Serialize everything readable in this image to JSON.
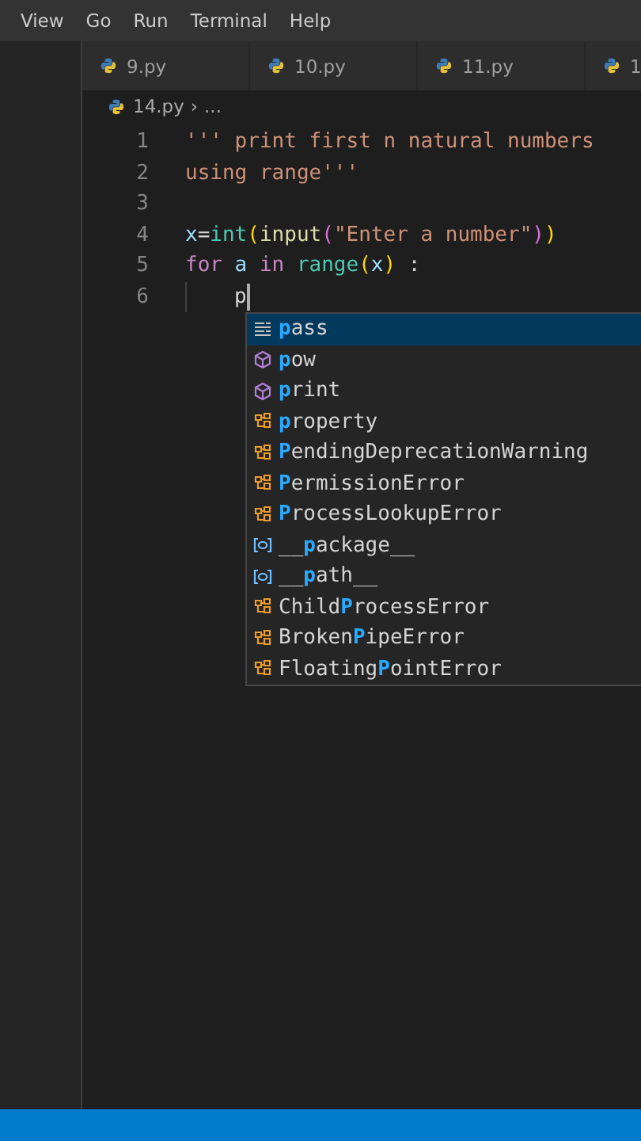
{
  "menu_bar": {
    "items": [
      "View",
      "Go",
      "Run",
      "Terminal",
      "Help"
    ]
  },
  "tabs": [
    {
      "label": "9.py"
    },
    {
      "label": "10.py"
    },
    {
      "label": "11.py"
    },
    {
      "label": "1"
    }
  ],
  "breadcrumb": {
    "file": "14.py",
    "separator": "›",
    "symbol": "..."
  },
  "editor": {
    "lines": [
      {
        "number": "1",
        "tokens": [
          {
            "text": "''' print first n natural numbers",
            "color": "#ce9178"
          }
        ]
      },
      {
        "number": "2",
        "tokens": [
          {
            "text": "using range'''",
            "color": "#ce9178"
          }
        ]
      },
      {
        "number": "3"
      },
      {
        "number": "4",
        "tokens": [
          {
            "text": "x",
            "color": "#9cdcfe"
          },
          {
            "text": "=",
            "color": "#d4d4d4"
          },
          {
            "text": "int",
            "color": "#4ec9b0"
          },
          {
            "text": "(",
            "color": "#ffd700"
          },
          {
            "text": "input",
            "color": "#dcdcaa"
          },
          {
            "text": "(",
            "color": "#da70d6"
          },
          {
            "text": "\"Enter a number\"",
            "color": "#ce9178"
          },
          {
            "text": ")",
            "color": "#da70d6"
          },
          {
            "text": ")",
            "color": "#ffd700"
          }
        ]
      },
      {
        "number": "5",
        "tokens": [
          {
            "text": "for",
            "color": "#c586c0"
          },
          {
            "text": " a",
            "color": "#9cdcfe"
          },
          {
            "text": " in",
            "color": "#c586c0"
          },
          {
            "text": " range",
            "color": "#4ec9b0"
          },
          {
            "text": "(",
            "color": "#ffd700"
          },
          {
            "text": "x",
            "color": "#9cdcfe"
          },
          {
            "text": ")",
            "color": "#ffd700"
          },
          {
            "text": " :",
            "color": "#d4d4d4"
          }
        ]
      },
      {
        "number": "6",
        "indent": true,
        "cursor": true,
        "tokens": [
          {
            "text": "p",
            "color": "#d4d4d4"
          }
        ]
      }
    ]
  },
  "suggestions": [
    {
      "kind": "keyword",
      "selected": true,
      "match": "p",
      "after": "ass"
    },
    {
      "kind": "function",
      "selected": false,
      "match": "p",
      "after": "ow"
    },
    {
      "kind": "function",
      "selected": false,
      "match": "p",
      "after": "rint"
    },
    {
      "kind": "class",
      "selected": false,
      "match": "p",
      "after": "roperty"
    },
    {
      "kind": "class",
      "selected": false,
      "match": "P",
      "after": "endingDeprecationWarning"
    },
    {
      "kind": "class",
      "selected": false,
      "match": "P",
      "after": "ermissionError"
    },
    {
      "kind": "class",
      "selected": false,
      "match": "P",
      "after": "rocessLookupError"
    },
    {
      "kind": "variable",
      "selected": false,
      "before": "__",
      "match": "p",
      "after": "ackage__"
    },
    {
      "kind": "variable",
      "selected": false,
      "before": "__",
      "match": "p",
      "after": "ath__"
    },
    {
      "kind": "class",
      "selected": false,
      "before": "Child",
      "match": "P",
      "after": "rocessError"
    },
    {
      "kind": "class",
      "selected": false,
      "before": "Broken",
      "match": "P",
      "after": "ipeError"
    },
    {
      "kind": "class",
      "selected": false,
      "before": "Floating",
      "match": "P",
      "after": "ointError"
    }
  ]
}
